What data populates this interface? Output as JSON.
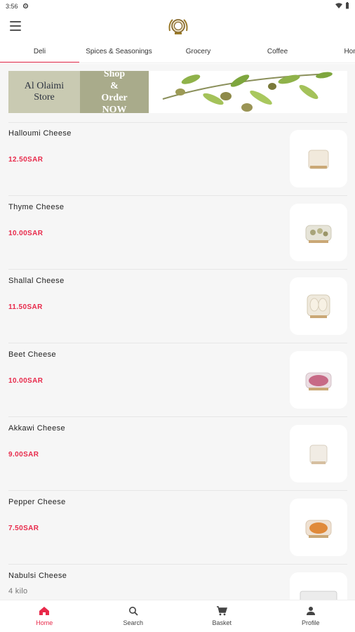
{
  "status_bar": {
    "time": "3:56"
  },
  "tabs": [
    {
      "label": "Deli",
      "active": true
    },
    {
      "label": "Spices & Seasonings",
      "active": false
    },
    {
      "label": "Grocery",
      "active": false
    },
    {
      "label": "Coffee",
      "active": false
    },
    {
      "label": "Home E",
      "active": false
    }
  ],
  "banner": {
    "store_name": "Al Olaimi\nStore",
    "cta": "Shop\n&\nOrder\nNOW"
  },
  "products": [
    {
      "name": "Halloumi Cheese",
      "price": "12.50SAR",
      "image": "halloumi-cheese-image"
    },
    {
      "name": "Thyme Cheese",
      "price": "10.00SAR",
      "image": "thyme-cheese-image"
    },
    {
      "name": "Shallal Cheese",
      "price": "11.50SAR",
      "image": "shallal-cheese-image"
    },
    {
      "name": "Beet Cheese",
      "price": "10.00SAR",
      "image": "beet-cheese-image"
    },
    {
      "name": "Akkawi Cheese",
      "price": "9.00SAR",
      "image": "akkawi-cheese-image"
    },
    {
      "name": "Pepper Cheese",
      "price": "7.50SAR",
      "image": "pepper-cheese-image"
    },
    {
      "name": "Nabulsi Cheese",
      "subtitle": "4 kilo",
      "image": "nabulsi-cheese-image"
    }
  ],
  "bottom_nav": [
    {
      "label": "Home",
      "icon": "home-icon",
      "active": true
    },
    {
      "label": "Search",
      "icon": "search-icon",
      "active": false
    },
    {
      "label": "Basket",
      "icon": "cart-icon",
      "active": false
    },
    {
      "label": "Profile",
      "icon": "person-icon",
      "active": false
    }
  ],
  "colors": {
    "accent": "#e8294a",
    "background": "#f6f6f6"
  }
}
